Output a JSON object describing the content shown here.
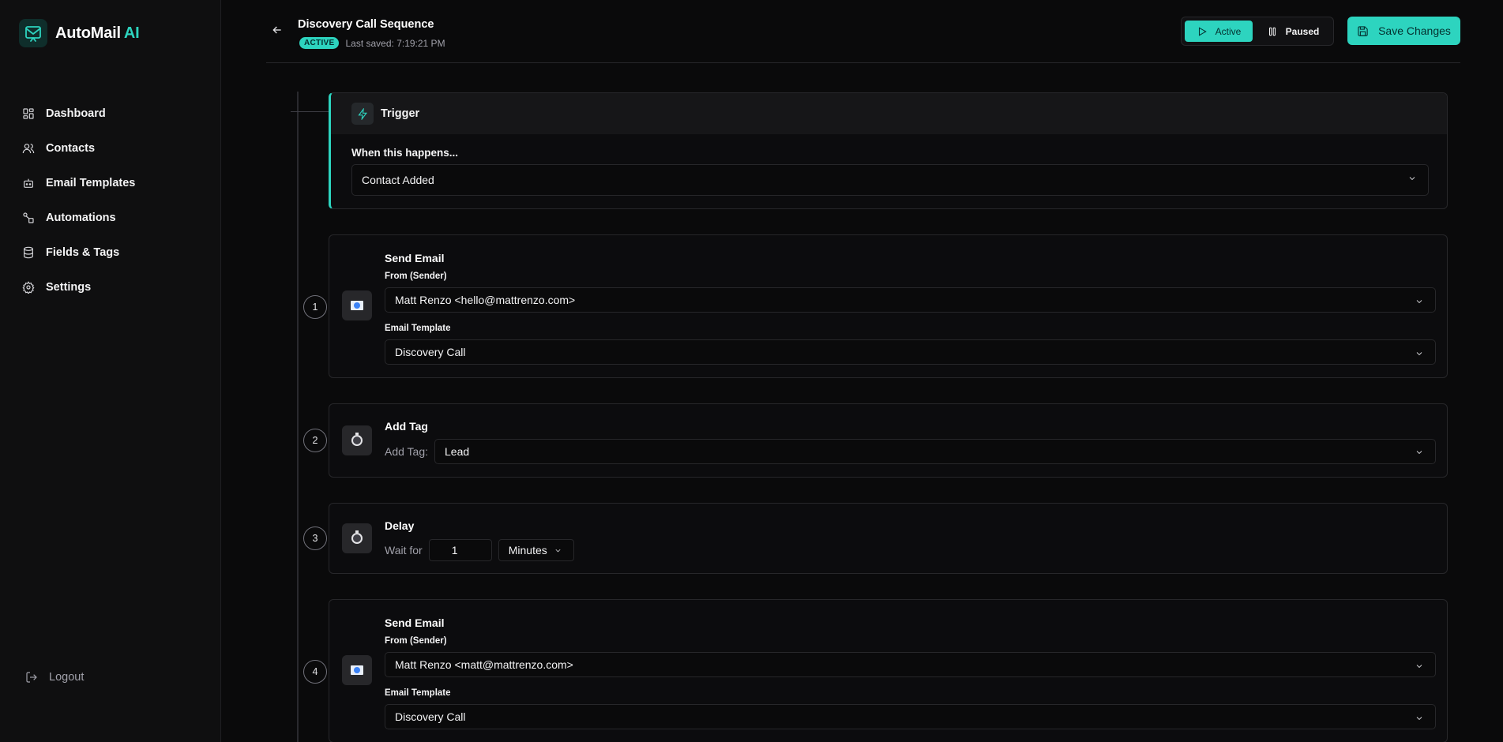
{
  "brand": {
    "name": "AutoMail",
    "suffix": "AI",
    "accent": "#2dd4bf"
  },
  "sidebar": {
    "items": [
      {
        "label": "Dashboard",
        "icon": "dashboard-icon"
      },
      {
        "label": "Contacts",
        "icon": "users-icon"
      },
      {
        "label": "Email Templates",
        "icon": "bot-icon"
      },
      {
        "label": "Automations",
        "icon": "workflow-icon"
      },
      {
        "label": "Fields & Tags",
        "icon": "database-icon"
      },
      {
        "label": "Settings",
        "icon": "gear-icon"
      }
    ],
    "logout_label": "Logout"
  },
  "header": {
    "title": "Discovery Call Sequence",
    "status_badge": "ACTIVE",
    "last_saved": "Last saved: 7:19:21 PM",
    "toggle": {
      "active_label": "Active",
      "paused_label": "Paused",
      "selected": "Active"
    },
    "save_label": "Save Changes"
  },
  "trigger": {
    "title": "Trigger",
    "label": "When this happens...",
    "value": "Contact Added"
  },
  "steps": [
    {
      "number": "1",
      "type": "Send Email",
      "icon": "envelope-icon",
      "from_label": "From (Sender)",
      "from_value": "Matt Renzo <hello@mattrenzo.com>",
      "template_label": "Email Template",
      "template_value": "Discovery Call"
    },
    {
      "number": "2",
      "type": "Add Tag",
      "icon": "stopwatch-icon",
      "tag_label": "Add Tag:",
      "tag_value": "Lead"
    },
    {
      "number": "3",
      "type": "Delay",
      "icon": "stopwatch-icon",
      "wait_label": "Wait for",
      "wait_value": "1",
      "unit": "Minutes"
    },
    {
      "number": "4",
      "type": "Send Email",
      "icon": "envelope-icon",
      "from_label": "From (Sender)",
      "from_value": "Matt Renzo <matt@mattrenzo.com>",
      "template_label": "Email Template",
      "template_value": "Discovery Call"
    }
  ]
}
